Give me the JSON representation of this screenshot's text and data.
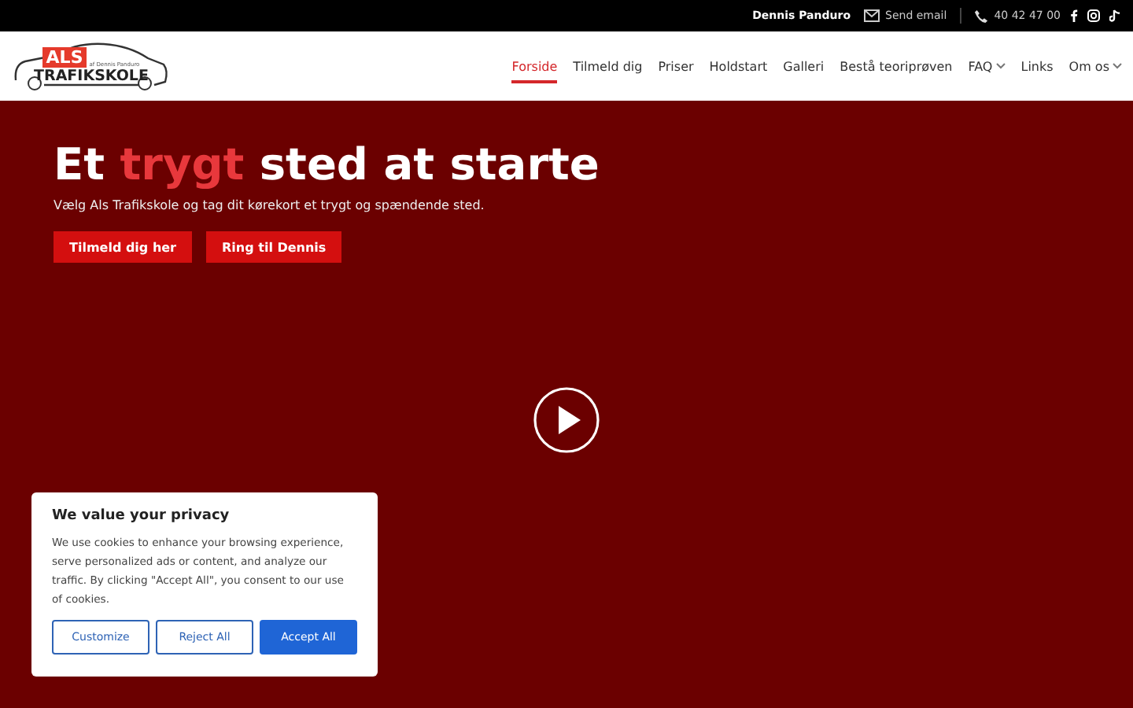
{
  "top_bar": {
    "name": "Dennis Panduro",
    "email": "Send email",
    "phone": "40 42 47 00"
  },
  "logo": {
    "badge": "ALS",
    "tagline": "af Dennis Panduro",
    "name": "TRAFIKSKOLE"
  },
  "nav": [
    {
      "label": "Forside",
      "selected": true,
      "dropdown": false
    },
    {
      "label": "Tilmeld dig",
      "selected": false,
      "dropdown": false
    },
    {
      "label": "Priser",
      "selected": false,
      "dropdown": false
    },
    {
      "label": "Holdstart",
      "selected": false,
      "dropdown": false
    },
    {
      "label": "Galleri",
      "selected": false,
      "dropdown": false
    },
    {
      "label": "Bestå teoriprøven",
      "selected": false,
      "dropdown": false
    },
    {
      "label": "FAQ",
      "selected": false,
      "dropdown": true
    },
    {
      "label": "Links",
      "selected": false,
      "dropdown": false
    },
    {
      "label": "Om os",
      "selected": false,
      "dropdown": true
    }
  ],
  "hero": {
    "headline": {
      "before": "Et",
      "highlight": "trygt",
      "after": "sted at starte"
    },
    "subtitle": "Vælg Als Trafikskole og tag dit kørekort et trygt og spændende sted.",
    "buttons": [
      "Tilmeld dig her",
      "Ring til Dennis"
    ]
  },
  "cookie_banner": {
    "title": "We value your privacy",
    "text": "We use cookies to enhance your browsing experience, serve personalized ads or content, and analyze our traffic. By clicking \"Accept All\", you consent to our use of cookies.",
    "buttons": [
      {
        "label": "Customize",
        "kind": "outline"
      },
      {
        "label": "Reject All",
        "kind": "outline"
      },
      {
        "label": "Accept All",
        "kind": "primary"
      }
    ]
  }
}
